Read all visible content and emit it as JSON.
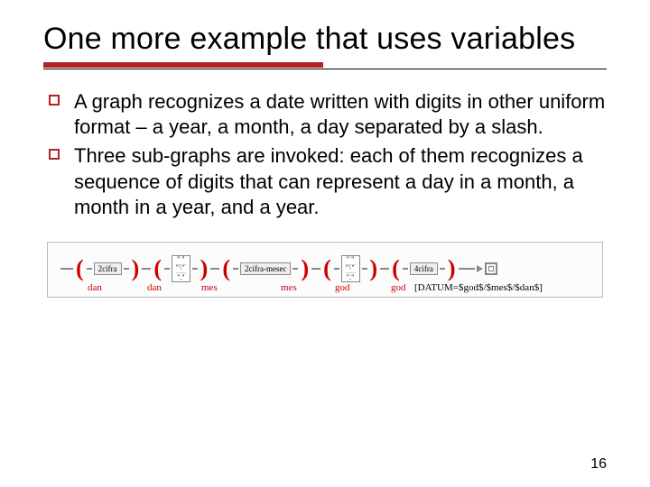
{
  "title": "One more example that uses variables",
  "bullets": [
    "A graph recognizes a date written with digits in other uniform format – a year, a month, a day separated by a slash.",
    "Three sub-graphs are invoked: each of them recognizes a sequence of digits that can represent a day in a month, a month in a year, and a year."
  ],
  "diagram": {
    "segments": [
      {
        "sub": "2cifra",
        "label": "dan"
      },
      {
        "alt_top": "\" \"",
        "alt_mid": "\"\\\"",
        "alt_bot": "\".\"",
        "label": "dan"
      },
      {
        "sub": "2cifra-mesec",
        "label": "mes"
      },
      {
        "alt_top": "\" \"",
        "alt_mid": "\"\\\"",
        "alt_bot": "\".\"",
        "label": "mes"
      },
      {
        "sub": "4cifra",
        "label": "god"
      }
    ],
    "final_label": "god",
    "output": "[DATUM=$god$/$mes$/$dan$]"
  },
  "page_number": "16"
}
